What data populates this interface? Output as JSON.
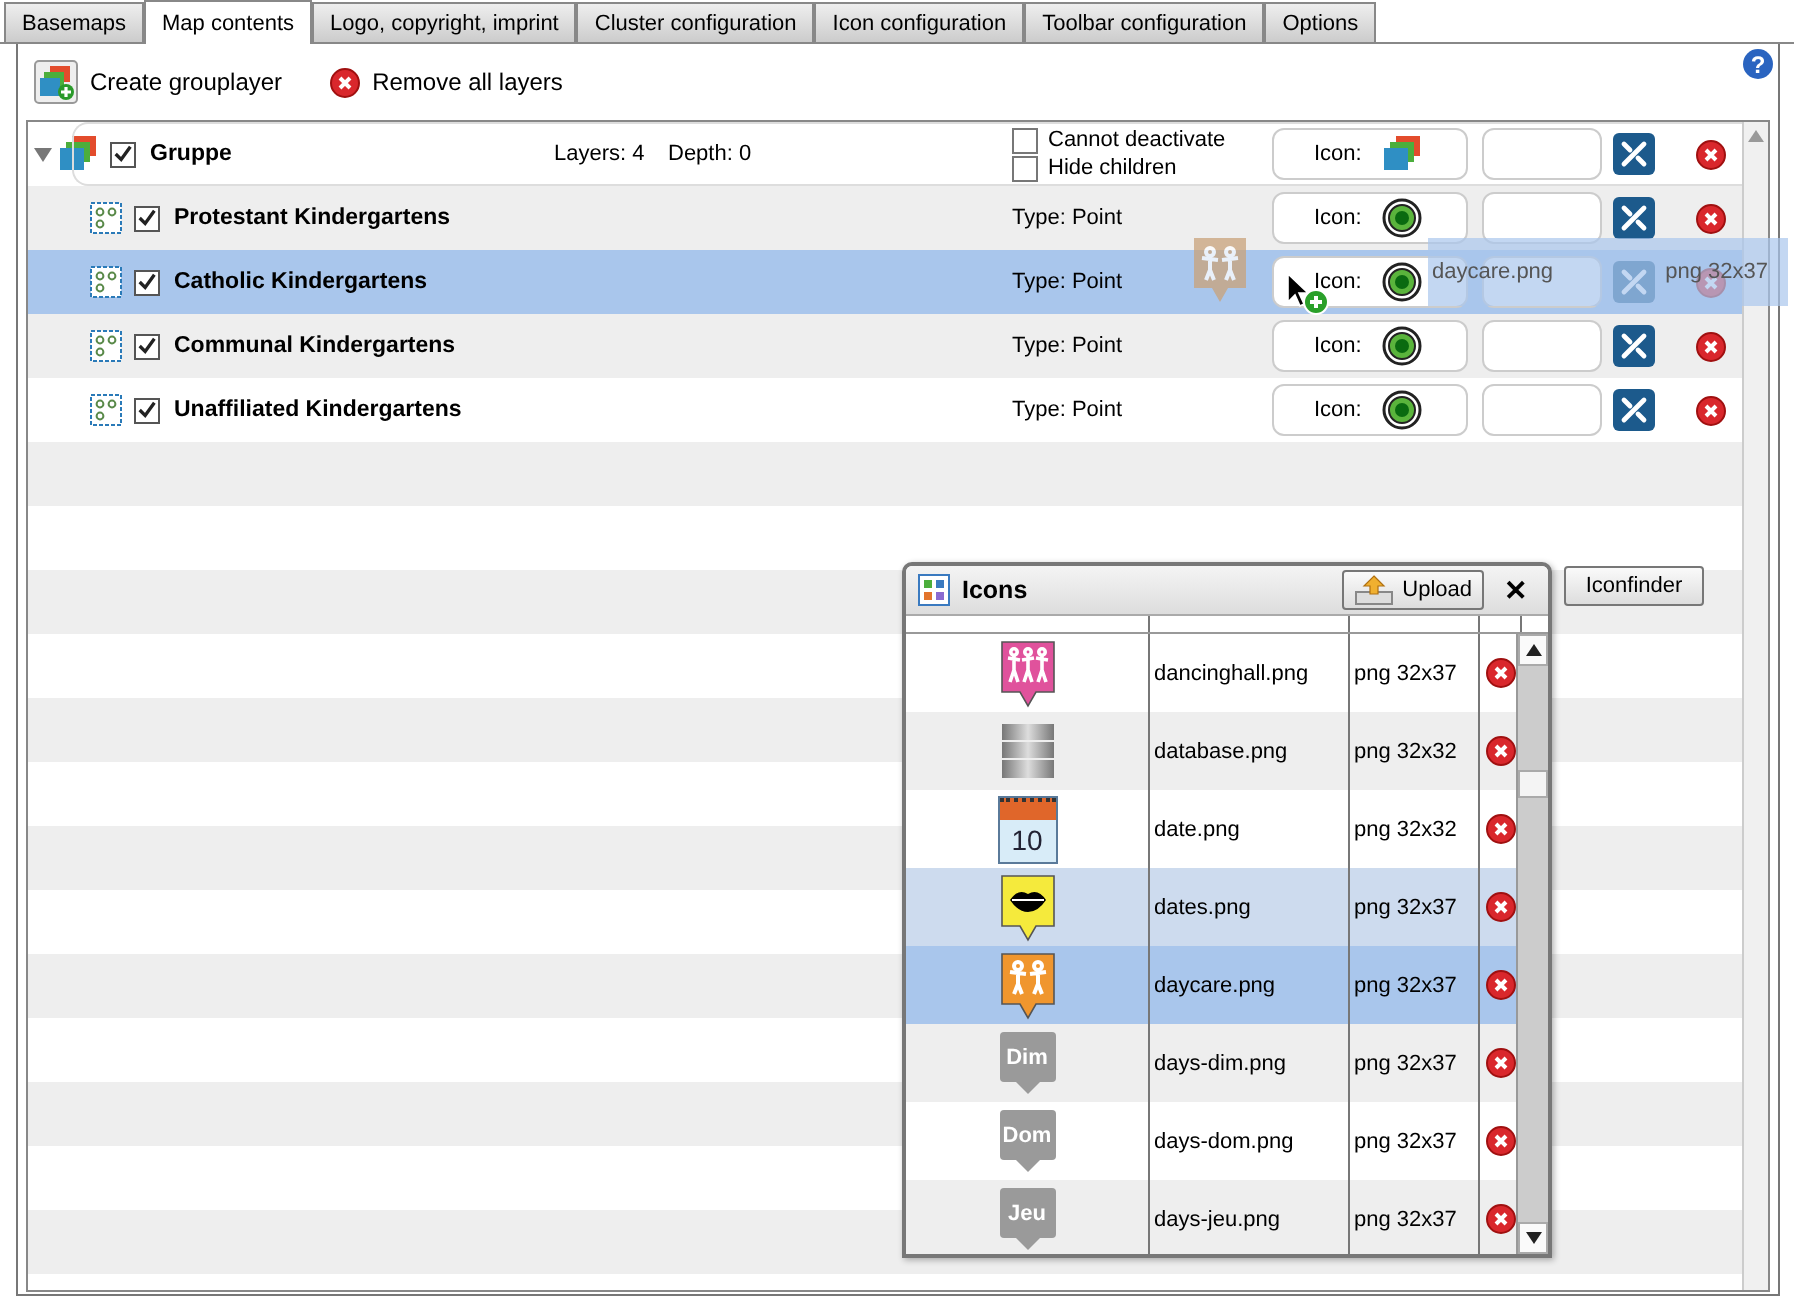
{
  "tabs": [
    {
      "label": "Basemaps",
      "selected": false
    },
    {
      "label": "Map contents",
      "selected": true
    },
    {
      "label": "Logo, copyright, imprint",
      "selected": false
    },
    {
      "label": "Cluster configuration",
      "selected": false
    },
    {
      "label": "Icon configuration",
      "selected": false
    },
    {
      "label": "Toolbar configuration",
      "selected": false
    },
    {
      "label": "Options",
      "selected": false
    }
  ],
  "toolbar": {
    "create": "Create grouplayer",
    "remove": "Remove all layers",
    "help": "?"
  },
  "group": {
    "name": "Gruppe",
    "expanded": true,
    "checked": true,
    "layers": "Layers: 4",
    "depth": "Depth: 0",
    "icon_label": "Icon:",
    "options": [
      {
        "label": "Cannot deactivate",
        "checked": false
      },
      {
        "label": "Hide children",
        "checked": false
      }
    ]
  },
  "layers": [
    {
      "name": "Protestant Kindergartens",
      "checked": true,
      "selected": false,
      "type": "Type: Point",
      "icon_label": "Icon:"
    },
    {
      "name": "Catholic Kindergartens",
      "checked": true,
      "selected": true,
      "type": "Type: Point",
      "icon_label": "Icon:"
    },
    {
      "name": "Communal Kindergartens",
      "checked": true,
      "selected": false,
      "type": "Type: Point",
      "icon_label": "Icon:"
    },
    {
      "name": "Unaffiliated Kindergartens",
      "checked": true,
      "selected": false,
      "type": "Type: Point",
      "icon_label": "Icon:"
    }
  ],
  "drag_ghost": {
    "name": "daycare.png",
    "info": "png 32x37"
  },
  "icons_dialog": {
    "title": "Icons",
    "upload": "Upload",
    "close": "✕",
    "rows": [
      {
        "kind": "dancers",
        "color": "#e0529c",
        "name": "dancinghall.png",
        "info": "png 32x37",
        "selected": false,
        "hovered": false
      },
      {
        "kind": "database",
        "name": "database.png",
        "info": "png 32x32",
        "selected": false,
        "hovered": false
      },
      {
        "kind": "calendar",
        "icon_text": "10",
        "name": "date.png",
        "info": "png 32x32",
        "selected": false,
        "hovered": false
      },
      {
        "kind": "lips",
        "color": "#f5ea3c",
        "name": "dates.png",
        "info": "png 32x37",
        "selected": false,
        "hovered": true
      },
      {
        "kind": "children",
        "color": "#f0962e",
        "name": "daycare.png",
        "info": "png 32x37",
        "selected": true,
        "hovered": false
      },
      {
        "kind": "text-pin",
        "color": "#9a9a9a",
        "icon_text": "Dim",
        "name": "days-dim.png",
        "info": "png 32x37",
        "selected": false,
        "hovered": false
      },
      {
        "kind": "text-pin",
        "color": "#9a9a9a",
        "icon_text": "Dom",
        "name": "days-dom.png",
        "info": "png 32x37",
        "selected": false,
        "hovered": false
      },
      {
        "kind": "text-pin",
        "color": "#9a9a9a",
        "icon_text": "Jeu",
        "name": "days-jeu.png",
        "info": "png 32x37",
        "selected": false,
        "hovered": false
      }
    ]
  },
  "iconfinder": "Iconfinder"
}
